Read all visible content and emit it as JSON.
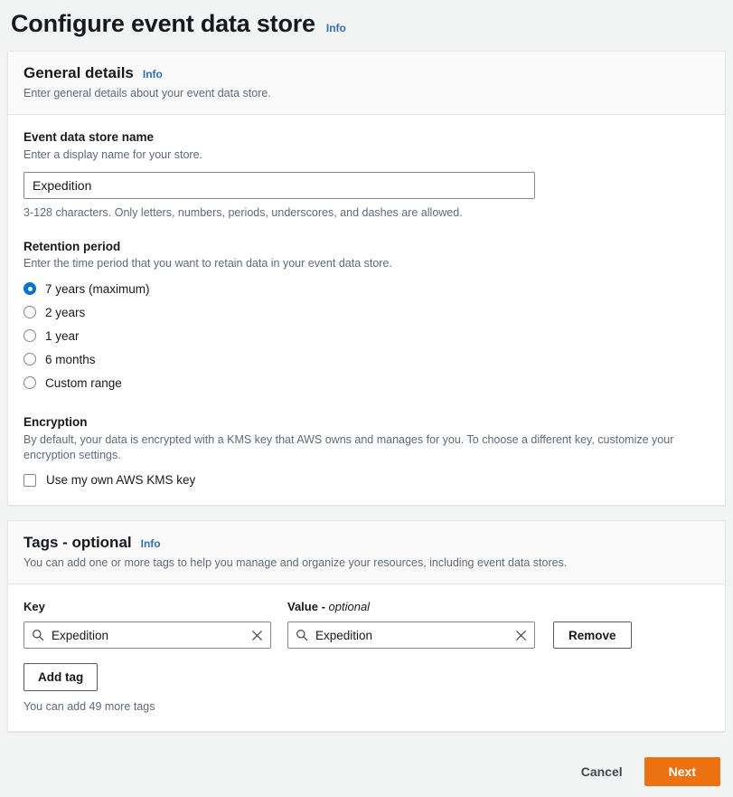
{
  "page": {
    "title": "Configure event data store",
    "info_label": "Info"
  },
  "general_details": {
    "title": "General details",
    "info_label": "Info",
    "description": "Enter general details about your event data store.",
    "name_field": {
      "label": "Event data store name",
      "description": "Enter a display name for your store.",
      "value": "Expedition",
      "placeholder": "",
      "constraint": "3-128 characters. Only letters, numbers, periods, underscores, and dashes are allowed."
    },
    "retention": {
      "label": "Retention period",
      "description": "Enter the time period that you want to retain data in your event data store.",
      "options": [
        {
          "label": "7 years (maximum)",
          "selected": true
        },
        {
          "label": "2 years",
          "selected": false
        },
        {
          "label": "1 year",
          "selected": false
        },
        {
          "label": "6 months",
          "selected": false
        },
        {
          "label": "Custom range",
          "selected": false
        }
      ]
    },
    "encryption": {
      "label": "Encryption",
      "description": "By default, your data is encrypted with a KMS key that AWS owns and manages for you. To choose a different key, customize your encryption settings.",
      "checkbox_label": "Use my own AWS KMS key",
      "checked": false
    }
  },
  "tags": {
    "title": "Tags - optional",
    "info_label": "Info",
    "description": "You can add one or more tags to help you manage and organize your resources, including event data stores.",
    "key_header": "Key",
    "value_header_main": "Value - ",
    "value_header_optional": "optional",
    "rows": [
      {
        "key_value": "Expedition",
        "key_placeholder": "",
        "value_value": "Expedition",
        "value_placeholder": "",
        "remove_label": "Remove"
      }
    ],
    "add_tag_label": "Add tag",
    "more_tags_text": "You can add 49 more tags"
  },
  "footer": {
    "cancel_label": "Cancel",
    "next_label": "Next"
  },
  "colors": {
    "accent_blue": "#0972d3",
    "info_link": "#2f6fb3",
    "primary_orange": "#ec7211",
    "page_background": "#f2f3f3",
    "card_background": "#ffffff",
    "secondary_text": "#5f6b7a"
  },
  "icons": {
    "search": "search-icon",
    "clear": "close-icon"
  }
}
